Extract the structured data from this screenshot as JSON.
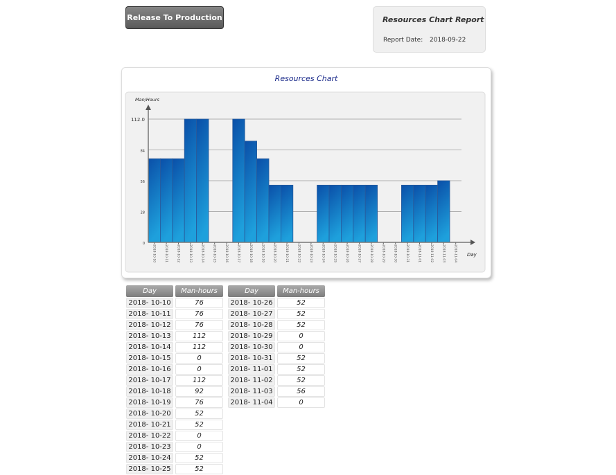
{
  "button": {
    "label": "Release To Production"
  },
  "report": {
    "title": "Resources  Chart Report",
    "date_label": "Report Date:",
    "date_value": "2018-09-22"
  },
  "chart_data": {
    "type": "bar",
    "title": "Resources Chart",
    "ylabel": "Man/Hours",
    "xlabel": "Day",
    "ylim": [
      0,
      112
    ],
    "yticks": [
      "0",
      "28",
      "56",
      "84",
      "112.0"
    ],
    "grid": true,
    "bar_color_top": "#0a4fa8",
    "bar_color_bottom": "#1ea0dc",
    "categories": [
      "2018-10-10",
      "2018-10-11",
      "2018-10-12",
      "2018-10-13",
      "2018-10-14",
      "2018-10-15",
      "2018-10-16",
      "2018-10-17",
      "2018-10-18",
      "2018-10-19",
      "2018-10-20",
      "2018-10-21",
      "2018-10-22",
      "2018-10-23",
      "2018-10-24",
      "2018-10-25",
      "2018-10-26",
      "2018-10-27",
      "2018-10-28",
      "2018-10-29",
      "2018-10-30",
      "2018-10-31",
      "2018-11-01",
      "2018-11-02",
      "2018-11-03",
      "2018-11-04"
    ],
    "values": [
      76,
      76,
      76,
      112,
      112,
      0,
      0,
      112,
      92,
      76,
      52,
      52,
      0,
      0,
      52,
      52,
      52,
      52,
      52,
      0,
      0,
      52,
      52,
      52,
      56,
      0
    ]
  },
  "table": {
    "headers": [
      "Day",
      "Man-hours"
    ],
    "display_days": [
      "2018- 10-10",
      "2018- 10-11",
      "2018- 10-12",
      "2018- 10-13",
      "2018- 10-14",
      "2018- 10-15",
      "2018- 10-16",
      "2018- 10-17",
      "2018- 10-18",
      "2018- 10-19",
      "2018- 10-20",
      "2018- 10-21",
      "2018- 10-22",
      "2018- 10-23",
      "2018- 10-24",
      "2018- 10-25",
      "2018- 10-26",
      "2018- 10-27",
      "2018- 10-28",
      "2018- 10-29",
      "2018- 10-30",
      "2018- 10-31",
      "2018- 11-01",
      "2018- 11-02",
      "2018- 11-03",
      "2018- 11-04"
    ]
  }
}
